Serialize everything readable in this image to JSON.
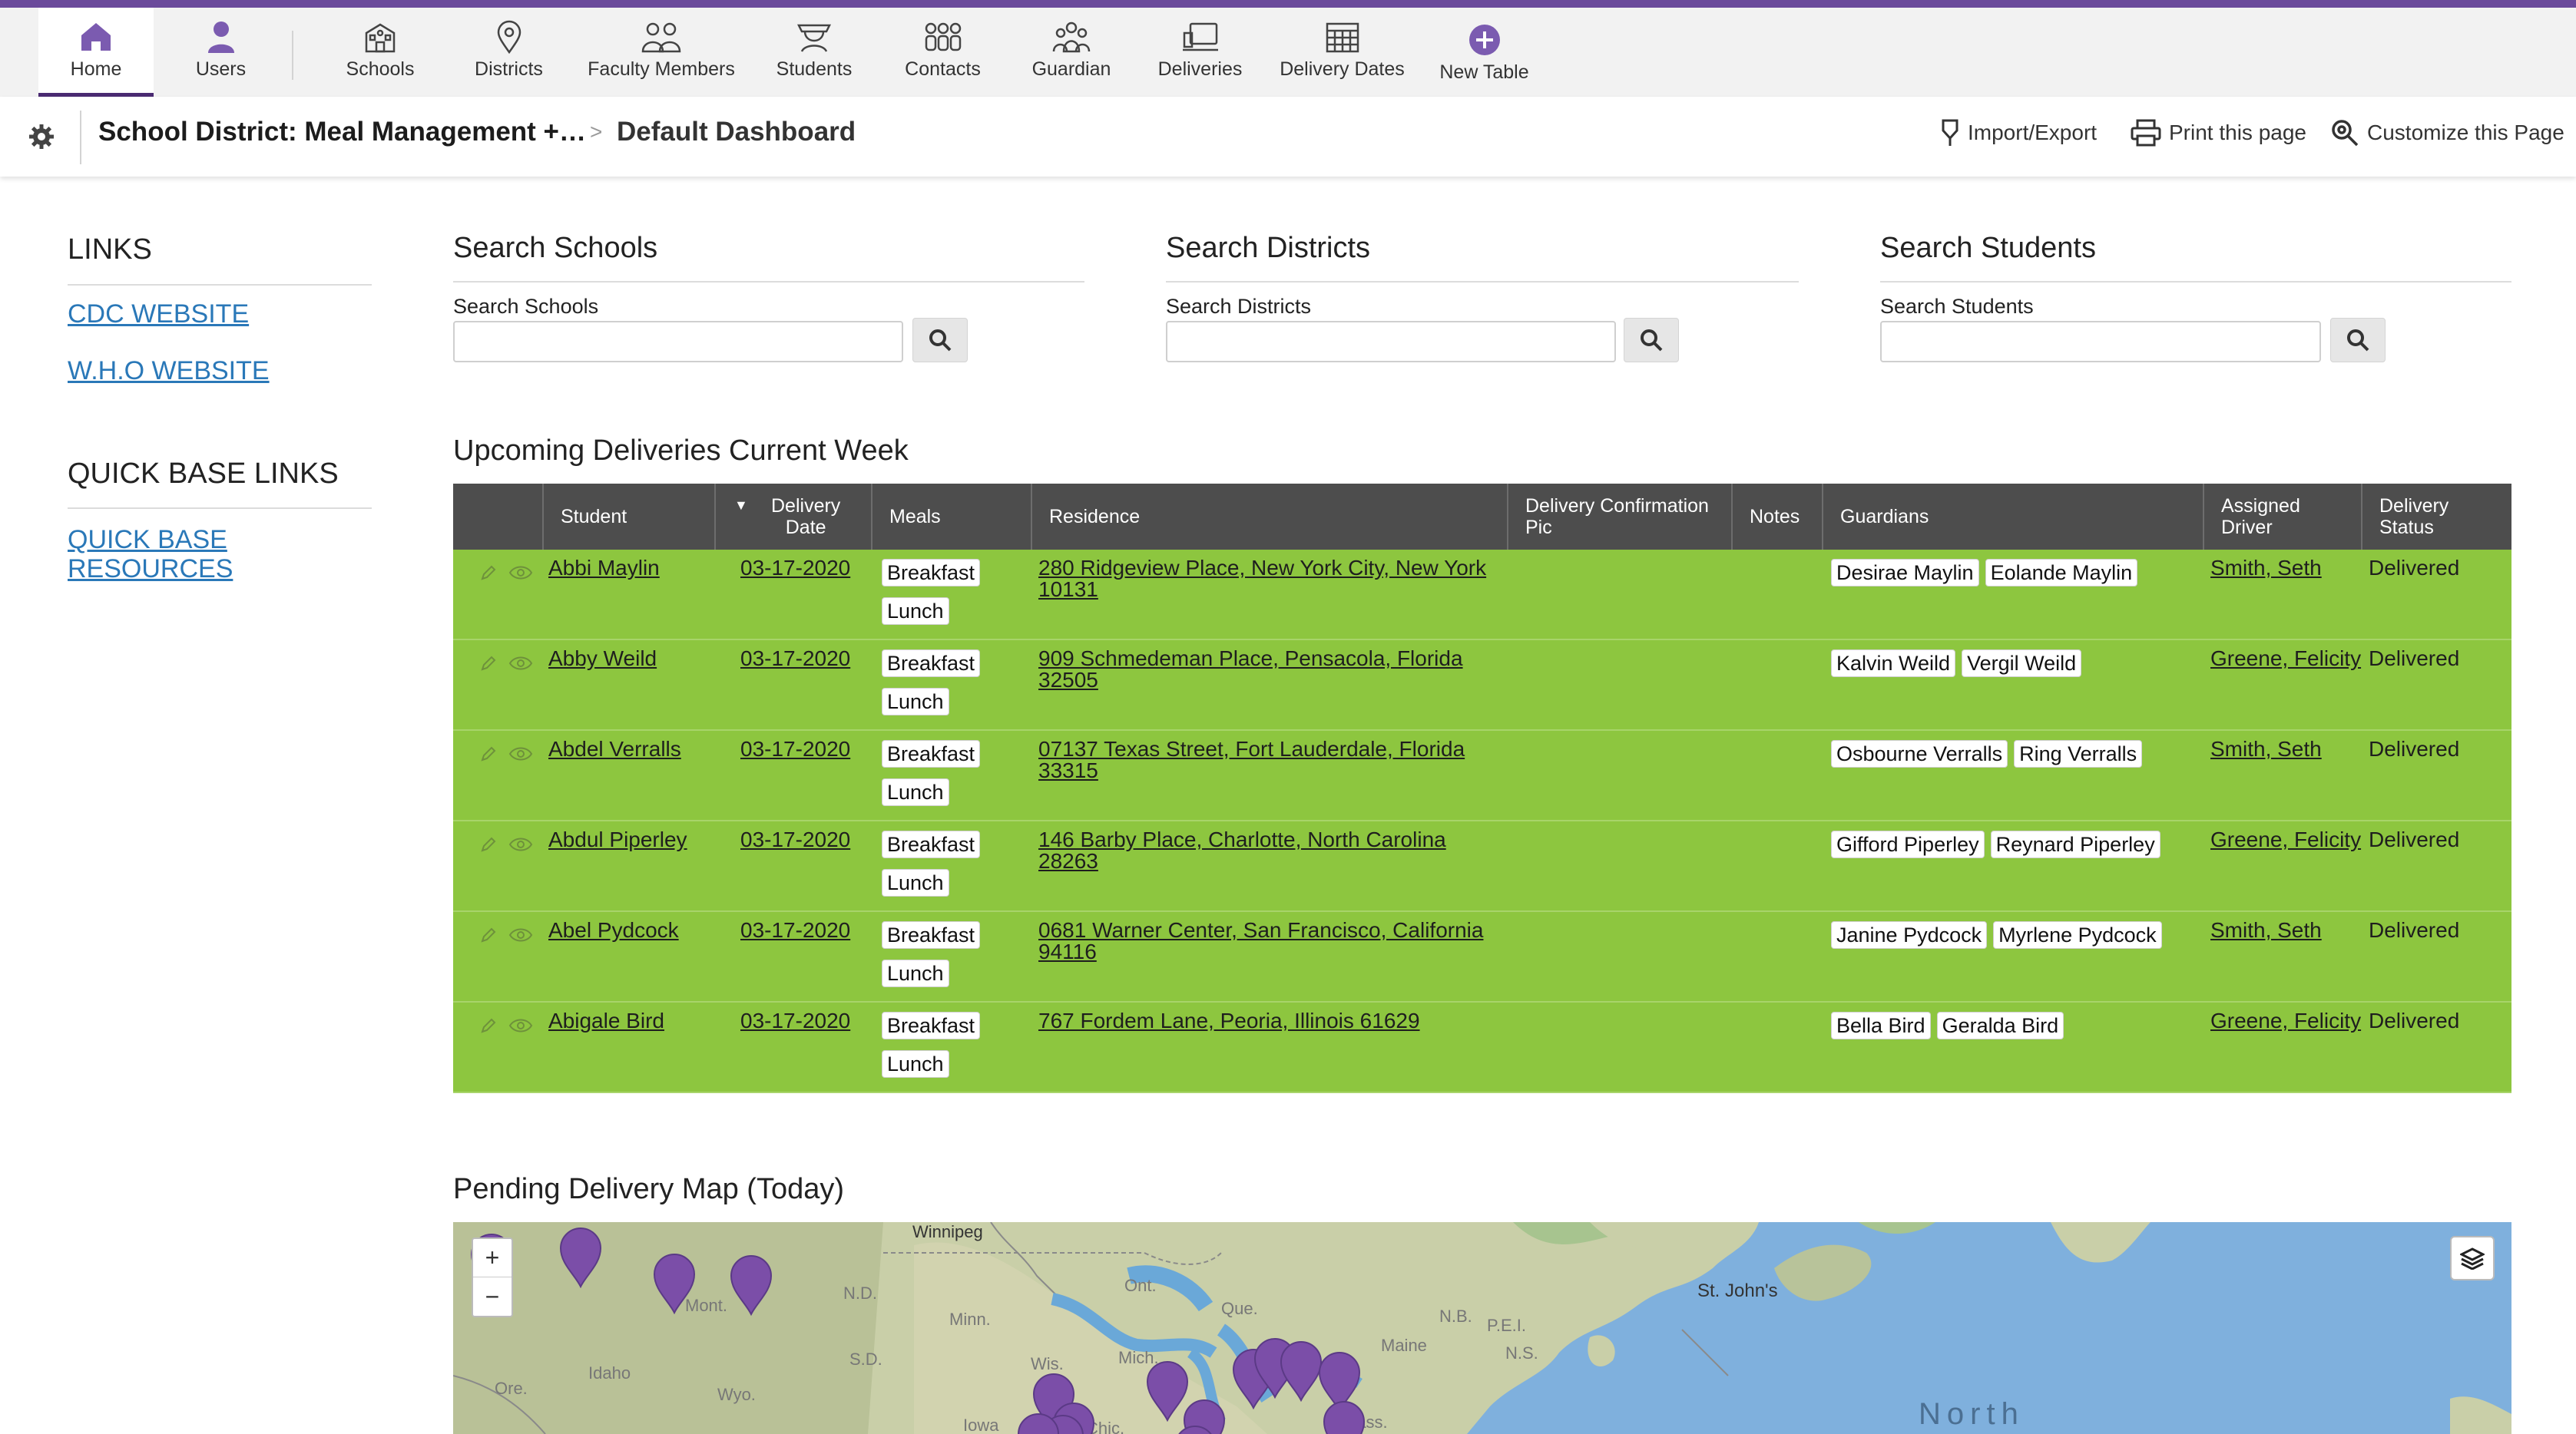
{
  "nav": {
    "items": [
      {
        "label": "Home",
        "icon": "home-icon"
      },
      {
        "label": "Users",
        "icon": "user-icon"
      },
      {
        "label": "Schools",
        "icon": "school-icon"
      },
      {
        "label": "Districts",
        "icon": "map-pin-icon"
      },
      {
        "label": "Faculty Members",
        "icon": "faculty-icon"
      },
      {
        "label": "Students",
        "icon": "students-icon"
      },
      {
        "label": "Contacts",
        "icon": "contacts-icon"
      },
      {
        "label": "Guardian",
        "icon": "guardian-icon"
      },
      {
        "label": "Deliveries",
        "icon": "deliveries-icon"
      },
      {
        "label": "Delivery Dates",
        "icon": "calendar-icon"
      },
      {
        "label": "New Table",
        "icon": "plus-circle-icon"
      }
    ]
  },
  "breadcrumb": {
    "app": "School District: Meal Management +…",
    "separator": ">",
    "page": "Default Dashboard"
  },
  "actions": {
    "import_export": "Import/Export",
    "print": "Print this page",
    "customize": "Customize this Page"
  },
  "links": {
    "title": "LINKS",
    "items": [
      "CDC WEBSITE",
      "W.H.O WEBSITE"
    ],
    "qb_title": "QUICK BASE LINKS",
    "qb_line1": "QUICK BASE",
    "qb_line2": "RESOURCES"
  },
  "search": [
    {
      "title": "Search Schools",
      "label": "Search Schools",
      "value": ""
    },
    {
      "title": "Search Districts",
      "label": "Search Districts",
      "value": ""
    },
    {
      "title": "Search Students",
      "label": "Search Students",
      "value": ""
    }
  ],
  "table": {
    "title": "Upcoming Deliveries Current Week",
    "headers": {
      "student": "Student",
      "date_l1": "Delivery",
      "date_l2": "Date",
      "meals": "Meals",
      "residence": "Residence",
      "pic_l1": "Delivery Confirmation",
      "pic_l2": "Pic",
      "notes": "Notes",
      "guardians": "Guardians",
      "driver_l1": "Assigned",
      "driver_l2": "Driver",
      "status_l1": "Delivery",
      "status_l2": "Status"
    },
    "rows": [
      {
        "student": "Abbi Maylin",
        "date": "03-17-2020",
        "meal1": "Breakfast",
        "meal2": "Lunch",
        "res1": "280 Ridgeview Place, New York City, New York",
        "res2": "10131",
        "g1": "Desirae Maylin",
        "g2": "Eolande Maylin",
        "driver": "Smith, Seth",
        "status": "Delivered"
      },
      {
        "student": "Abby Weild",
        "date": "03-17-2020",
        "meal1": "Breakfast",
        "meal2": "Lunch",
        "res1": "909 Schmedeman Place, Pensacola, Florida",
        "res2": "32505",
        "g1": "Kalvin Weild",
        "g2": "Vergil Weild",
        "driver": "Greene, Felicity",
        "status": "Delivered"
      },
      {
        "student": "Abdel Verralls",
        "date": "03-17-2020",
        "meal1": "Breakfast",
        "meal2": "Lunch",
        "res1": "07137 Texas Street, Fort Lauderdale, Florida",
        "res2": "33315",
        "g1": "Osbourne Verralls",
        "g2": "Ring Verralls",
        "driver": "Smith, Seth",
        "status": "Delivered"
      },
      {
        "student": "Abdul Piperley",
        "date": "03-17-2020",
        "meal1": "Breakfast",
        "meal2": "Lunch",
        "res1": "146 Barby Place, Charlotte, North Carolina 28263",
        "res2": "",
        "g1": "Gifford Piperley",
        "g2": "Reynard Piperley",
        "driver": "Greene, Felicity",
        "status": "Delivered"
      },
      {
        "student": "Abel Pydcock",
        "date": "03-17-2020",
        "meal1": "Breakfast",
        "meal2": "Lunch",
        "res1": "0681 Warner Center, San Francisco, California",
        "res2": "94116",
        "g1": "Janine Pydcock",
        "g2": "Myrlene Pydcock",
        "driver": "Smith, Seth",
        "status": "Delivered"
      },
      {
        "student": "Abigale Bird",
        "date": "03-17-2020",
        "meal1": "Breakfast",
        "meal2": "Lunch",
        "res1": "767 Fordem Lane, Peoria, Illinois 61629",
        "res2": "",
        "g1": "Bella Bird",
        "g2": "Geralda Bird",
        "driver": "Greene, Felicity",
        "status": "Delivered"
      }
    ]
  },
  "map": {
    "title": "Pending Delivery Map (Today)",
    "zoom_in": "+",
    "zoom_out": "−",
    "labels": [
      "Winnipeg",
      "St. John's",
      "Ont.",
      "N.D.",
      "Minn.",
      "S.D.",
      "Wis.",
      "Mich.",
      "Idaho",
      "Wyo.",
      "Ore.",
      "Mont.",
      "Maine",
      "N.B.",
      "P.E.I.",
      "N.S.",
      "Iowa",
      "Mass.",
      "Chic.",
      "Que."
    ],
    "ocean_label": "North",
    "pin_color": "#7b4ea8"
  },
  "colors": {
    "accent": "#6b4a9b",
    "row_bg": "#8dc63f",
    "header_bg": "#4d4d4d",
    "link": "#2a78b8"
  }
}
